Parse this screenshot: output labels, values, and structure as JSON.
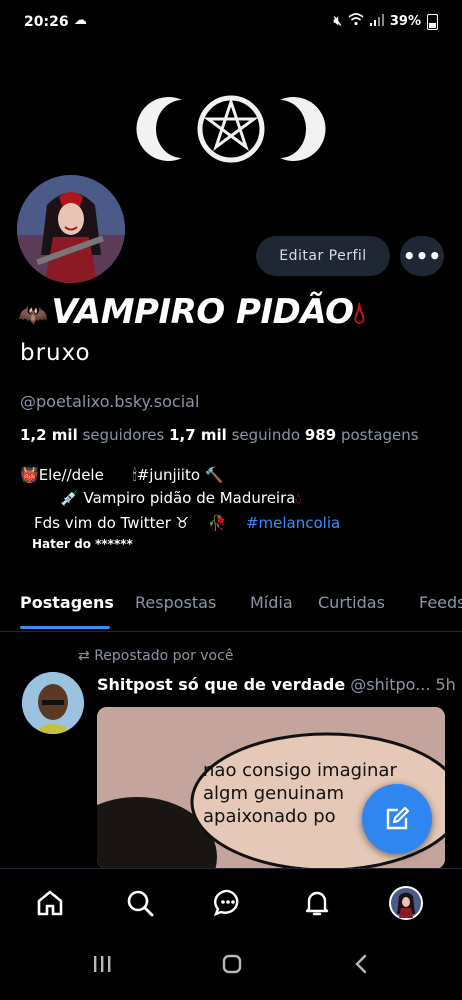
{
  "status_bar": {
    "time": "20:26",
    "battery": "39%"
  },
  "profile": {
    "display_name": "VAMPIRO PIDÃO",
    "subname": "bruxo",
    "handle": "@poetalixo.bsky.social",
    "edit_label": "Editar Perfil",
    "more_label": "•••",
    "stats": {
      "followers_count": "1,2 mil",
      "followers_label": "seguidores",
      "following_count": "1,7 mil",
      "following_label": "seguindo",
      "posts_count": "989",
      "posts_label": "postagens"
    },
    "bio": {
      "line1_a": "Ele//dele",
      "line1_b": "#junjiito",
      "line2": "Vampiro pidão de Madureira",
      "line3_a": "Fds vim do Twitter ♉",
      "line3_hashtag": "#melancolia",
      "line4": "Hater do ******"
    }
  },
  "tabs": [
    "Postagens",
    "Respostas",
    "Mídia",
    "Curtidas",
    "Feeds"
  ],
  "active_tab": "Postagens",
  "post": {
    "repost_label": "Repostado por você",
    "author": "Shitpost só que de verdade",
    "author_handle": "@shitpo...",
    "time": "5h",
    "image_text": [
      "nao consigo imaginar",
      "algm genuinam",
      "apaixonado po"
    ]
  },
  "colors": {
    "accent": "#3a8bf7",
    "muted": "#8a95a5",
    "button_bg": "#1e2733",
    "fab": "#2f86f0"
  },
  "icons": [
    "home-icon",
    "search-icon",
    "chat-icon",
    "bell-icon",
    "profile-avatar-icon",
    "pencil-icon"
  ]
}
